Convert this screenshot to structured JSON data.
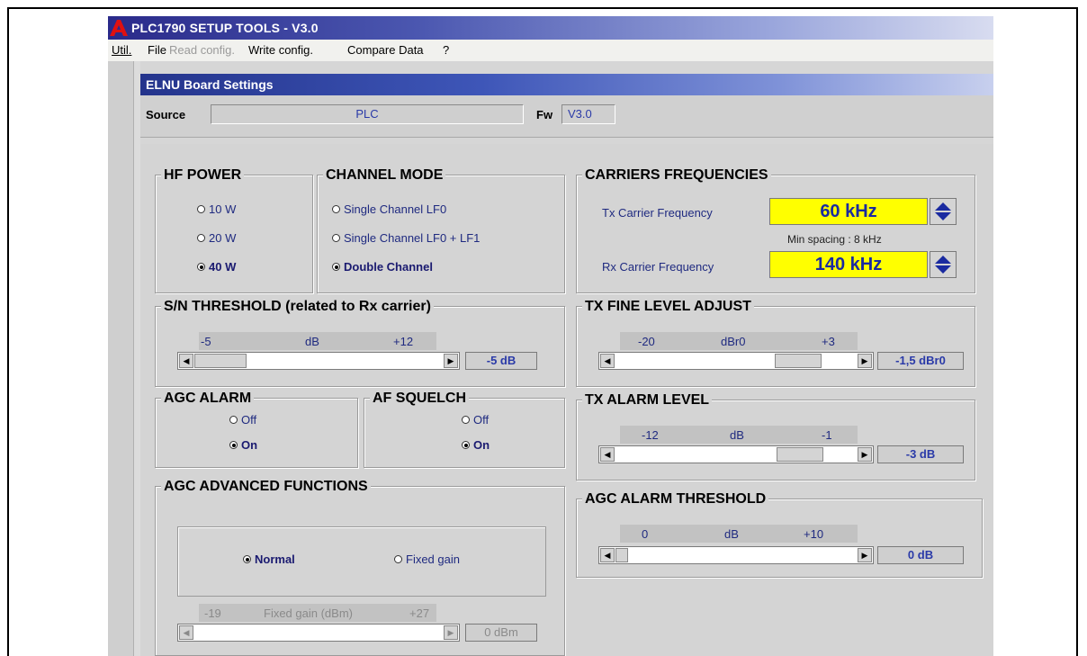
{
  "title": "PLC1790 SETUP TOOLS  -  V3.0",
  "menu": [
    "Util.",
    "File",
    "Read config.",
    "Write config.",
    "Compare Data",
    "?"
  ],
  "subwindow_title": "ELNU Board Settings",
  "source": {
    "label": "Source",
    "value": "PLC",
    "fw_label": "Fw",
    "fw_value": "V3.0"
  },
  "hf_power": {
    "title": "HF POWER",
    "options": [
      "10 W",
      "20 W",
      "40 W"
    ],
    "selected": "40 W"
  },
  "channel_mode": {
    "title": "CHANNEL MODE",
    "options": [
      "Single Channel LF0",
      "Single Channel LF0 + LF1",
      "Double Channel"
    ],
    "selected": "Double Channel"
  },
  "carriers": {
    "title": "CARRIERS FREQUENCIES",
    "tx_label": "Tx Carrier Frequency",
    "tx_value": "60 kHz",
    "spacing": "Min spacing : 8 kHz",
    "rx_label": "Rx Carrier Frequency",
    "rx_value": "140 kHz"
  },
  "sn_threshold": {
    "title": "S/N THRESHOLD (related to Rx carrier)",
    "min": "-5",
    "unit": "dB",
    "max": "+12",
    "value": "-5 dB",
    "position": 0.0
  },
  "tx_fine": {
    "title": "TX FINE LEVEL ADJUST",
    "min": "-20",
    "unit": "dBr0",
    "max": "+3",
    "value": "-1,5 dBr0",
    "position": 0.81
  },
  "agc_alarm": {
    "title": "AGC ALARM",
    "options": [
      "Off",
      "On"
    ],
    "selected": "On"
  },
  "af_squelch": {
    "title": "AF SQUELCH",
    "options": [
      "Off",
      "On"
    ],
    "selected": "On"
  },
  "tx_alarm": {
    "title": "TX ALARM LEVEL",
    "min": "-12",
    "unit": "dB",
    "max": "-1",
    "value": "-3 dB",
    "position": 0.82
  },
  "agc_advanced": {
    "title": "AGC ADVANCED FUNCTIONS",
    "options": [
      "Normal",
      "Fixed gain"
    ],
    "selected": "Normal",
    "min": "-19",
    "unit": "Fixed gain (dBm)",
    "max": "+27",
    "value": "0 dBm"
  },
  "agc_threshold": {
    "title": "AGC ALARM THRESHOLD",
    "min": "0",
    "unit": "dB",
    "max": "+10",
    "value": "0 dB",
    "position": 0.0
  },
  "colors": {
    "title_blue": "#2a2a8a",
    "freq_yellow": "#ffff00",
    "value_blue": "#2a3aa8"
  }
}
